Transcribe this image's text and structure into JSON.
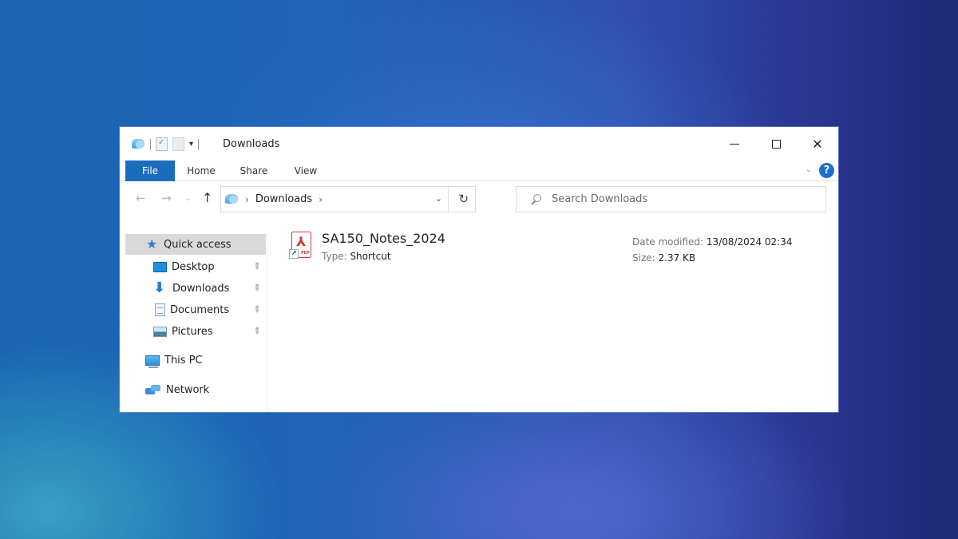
{
  "window": {
    "title": "Downloads",
    "quick_access_toolbar": [
      {
        "icon": "folder-icon"
      },
      {
        "icon": "properties-icon"
      },
      {
        "icon": "new-folder-icon"
      },
      {
        "icon": "customize-dropdown-icon",
        "glyph": "▾"
      }
    ],
    "controls": {
      "minimize": "minimize-icon",
      "maximize": "maximize-icon",
      "close_glyph": "✕"
    }
  },
  "ribbon": {
    "tabs": [
      {
        "label": "File",
        "active": true
      },
      {
        "label": "Home"
      },
      {
        "label": "Share"
      },
      {
        "label": "View"
      }
    ],
    "expand_glyph": "⌄",
    "help_glyph": "?"
  },
  "navbar": {
    "back_glyph": "←",
    "forward_glyph": "→",
    "recent_glyph": "⌄",
    "up_glyph": "↑",
    "address": {
      "chevron": "›",
      "path": [
        "Downloads"
      ],
      "trail_chevron": "›",
      "dropdown_glyph": "⌄",
      "refresh_glyph": "↻"
    },
    "search": {
      "placeholder": "Search Downloads",
      "value": ""
    }
  },
  "sidebar": {
    "quick_access": {
      "label": "Quick access",
      "selected": true
    },
    "pinned": [
      {
        "label": "Desktop",
        "icon": "desktop-icon",
        "pinned": true
      },
      {
        "label": "Downloads",
        "icon": "downloads-icon",
        "pinned": true
      },
      {
        "label": "Documents",
        "icon": "documents-icon",
        "pinned": true
      },
      {
        "label": "Pictures",
        "icon": "pictures-icon",
        "pinned": true
      }
    ],
    "this_pc": {
      "label": "This PC"
    },
    "network": {
      "label": "Network"
    },
    "pin_glyph": "📌"
  },
  "files": [
    {
      "name": "SA150_Notes_2024",
      "type_label": "Type:",
      "type": "Shortcut",
      "date_label": "Date modified:",
      "date_modified": "13/08/2024 02:34",
      "size_label": "Size:",
      "size": "2.37 KB",
      "icon": "pdf-shortcut-icon"
    }
  ],
  "colors": {
    "file_tab": "#1c6cbe",
    "selection": "#d9d9d9",
    "pdf_red": "#d8322a",
    "help": "#1a6fd0"
  }
}
